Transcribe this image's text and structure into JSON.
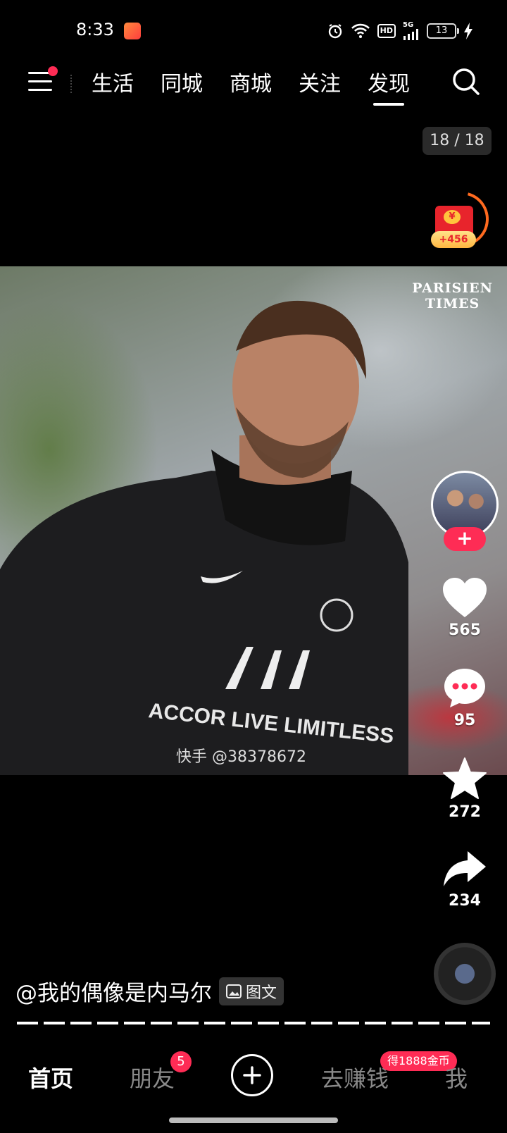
{
  "status_bar": {
    "time": "8:33",
    "app_icon": "short-video-app-icon",
    "hd_label": "HD",
    "network_label": "5G",
    "battery_level": "13"
  },
  "top_nav": {
    "tabs": [
      {
        "label": "生活",
        "active": false
      },
      {
        "label": "同城",
        "active": false
      },
      {
        "label": "商城",
        "active": false
      },
      {
        "label": "关注",
        "active": false
      },
      {
        "label": "发现",
        "active": true
      }
    ]
  },
  "photo_counter": "18 / 18",
  "red_packet": {
    "coin": "¥",
    "amount": "+456"
  },
  "photo": {
    "watermark_logo": [
      "PARISIEN",
      "TIMES"
    ],
    "app_watermark": "快手 @38378672"
  },
  "actions": {
    "like_count": "565",
    "comment_count": "95",
    "favorite_count": "272",
    "share_count": "234"
  },
  "caption": {
    "author": "@我的偶像是内马尔",
    "badge_label": "图文"
  },
  "bottom_nav": {
    "home": "首页",
    "friends": "朋友",
    "friends_badge": "5",
    "earn": "去赚钱",
    "earn_badge": "得1888金币",
    "me": "我"
  },
  "colors": {
    "accent": "#fe2c55",
    "background": "#000000",
    "red_packet": "#e8242c",
    "ring": "#ff6a1f"
  }
}
